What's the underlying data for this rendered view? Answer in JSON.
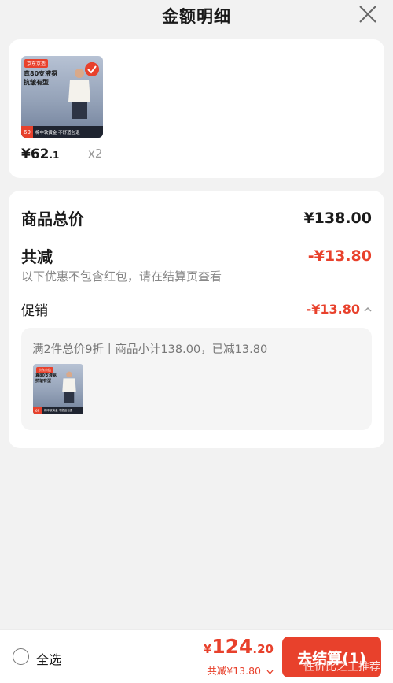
{
  "header": {
    "title": "金额明细"
  },
  "products": [
    {
      "price_main": "¥62",
      "price_decimal": ".1",
      "quantity": "x2",
      "image": {
        "shop_tag": "京东京造",
        "ad_line1": "真80支液氨",
        "ad_line2": "抗皱有型",
        "strip_price": "69",
        "strip_text": "棉中软黄金 不舒适包退"
      }
    }
  ],
  "detail": {
    "total_label": "商品总价",
    "total_value": "¥138.00",
    "reduce_label": "共减",
    "reduce_value": "-¥13.80",
    "note": "以下优惠不包含红包，请在结算页查看",
    "promo_label": "促销",
    "promo_value": "-¥13.80",
    "promo_desc": "满2件总价9折丨商品小计138.00，已减13.80"
  },
  "bottom": {
    "select_all": "全选",
    "total_yen": "¥",
    "total_int": "124",
    "total_dec": ".20",
    "reduced": "共减¥13.80",
    "checkout": "去结算(1)",
    "watermark": "性价比之王推荐"
  },
  "colors": {
    "accent": "#e8412c",
    "background": "#f2f2f2",
    "card": "#ffffff"
  },
  "icons": {
    "close": "close-icon",
    "chevron_up": "chevron-up-icon",
    "chevron_down": "chevron-down-icon"
  }
}
